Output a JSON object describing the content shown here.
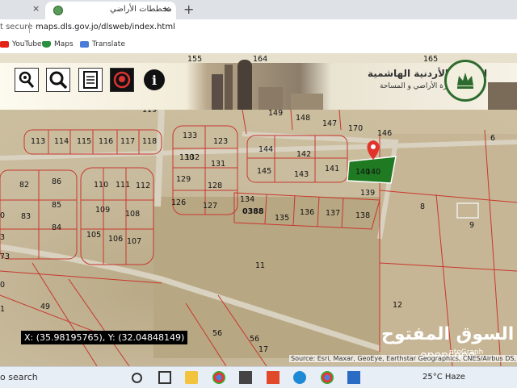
{
  "browser": {
    "tab": {
      "title": "مخططات الأراضي",
      "close_glyph": "×"
    },
    "new_tab_glyph": "+",
    "address": {
      "secure_label": "t secure",
      "url": "maps.dls.gov.jo/dlsweb/index.html"
    },
    "bookmarks": [
      {
        "label": "YouTube",
        "icon": "youtube-icon"
      },
      {
        "label": "Maps",
        "icon": "maps-icon"
      },
      {
        "label": "Translate",
        "icon": "translate-icon"
      }
    ]
  },
  "header": {
    "title": "المملكة الأردنية الهاشمية",
    "subtitle": "دائرة الأراضي و المساحة",
    "strip_numbers": [
      "155",
      "164",
      "165"
    ],
    "tools": [
      {
        "name": "locate-tool",
        "icon": "map-pin-search-icon"
      },
      {
        "name": "search-tool",
        "icon": "magnifier-icon"
      },
      {
        "name": "report-tool",
        "icon": "document-icon"
      },
      {
        "name": "marker-tool",
        "icon": "red-marker-icon"
      },
      {
        "name": "info-tool",
        "icon": "info-icon"
      }
    ]
  },
  "map": {
    "top_row_labels": [
      "119",
      "149",
      "148",
      "147",
      "170",
      "146"
    ],
    "parcel_labels": [
      "113",
      "114",
      "115",
      "116",
      "117",
      "118",
      "133",
      "123",
      "132",
      "130",
      "131",
      "129",
      "128",
      "126",
      "127",
      "144",
      "142",
      "145",
      "143",
      "141",
      "140",
      "139",
      "134",
      "135",
      "136",
      "137",
      "138",
      "86",
      "82",
      "83",
      "85",
      "84",
      "110",
      "111",
      "112",
      "109",
      "108",
      "105",
      "106",
      "107",
      "11",
      "8",
      "9",
      "6",
      "12",
      "49",
      "56",
      "56",
      "17",
      "3",
      "0",
      "0",
      "73",
      "1"
    ],
    "block_label": "0388",
    "selected_parcel": "140",
    "coordinates_text": "X: (35.98195765), Y: (32.04848149)",
    "attribution": "Source: Esri, Maxar, GeoEye, Earthstar Geographics, CNES/Airbus DS, US",
    "info_text": "ntoGraph",
    "watermark": "السوق المفتوح",
    "watermark_sub": "opensooq",
    "colors": {
      "parcel_line": "#c8372e",
      "selected_fill": "#1f7a22",
      "road": "#d9d2c0"
    }
  },
  "taskbar": {
    "search_label": "o search",
    "weather": "25°C Haze",
    "apps": [
      "cortana-icon",
      "task-view-icon",
      "file-explorer-icon",
      "chrome-icon",
      "store-icon",
      "office-icon",
      "edge-icon",
      "chrome-alt-icon",
      "mail-icon"
    ]
  }
}
